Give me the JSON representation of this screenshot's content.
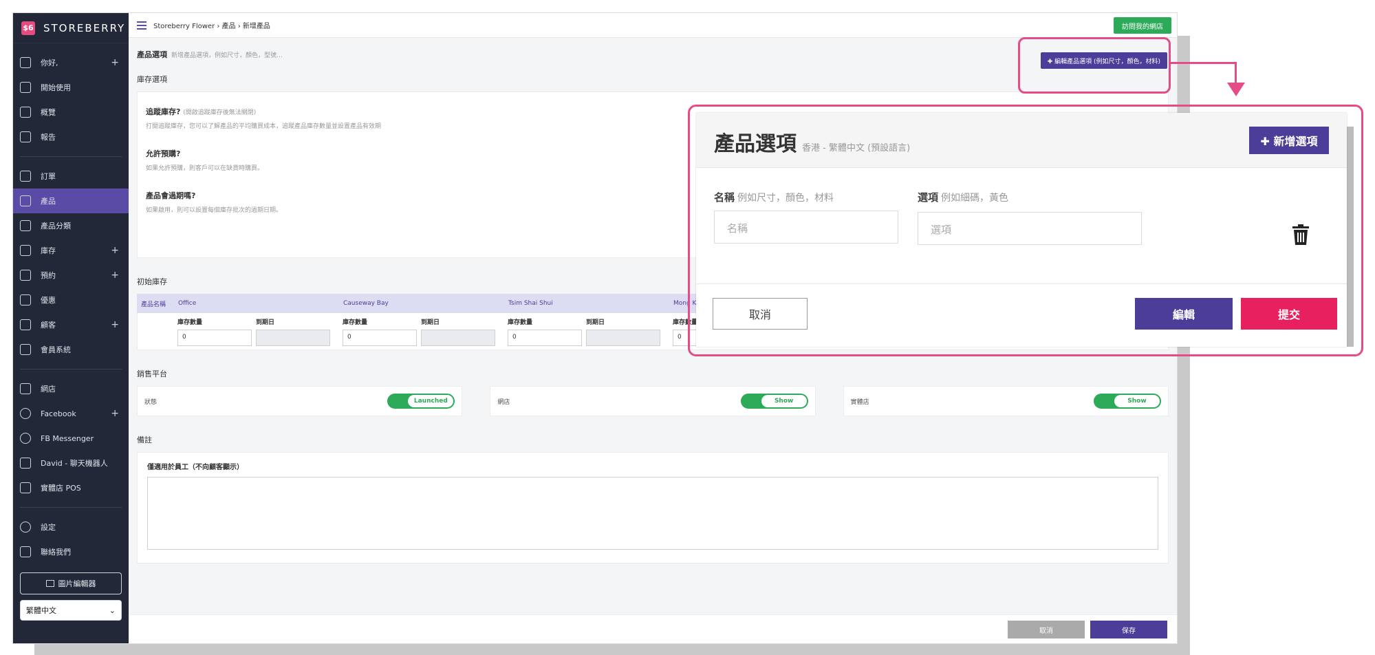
{
  "brand": {
    "name": "STOREBERRY",
    "logo": "$6"
  },
  "colors": {
    "accent": "#4b3d98",
    "highlight": "#e54b86",
    "success": "#2daa58",
    "danger": "#e8215e"
  },
  "sidebar": {
    "items": [
      {
        "label": "你好,",
        "icon": "user-icon",
        "plus": "+"
      },
      {
        "label": "開始使用",
        "icon": "flag-icon"
      },
      {
        "label": "概覽",
        "icon": "chart-icon"
      },
      {
        "label": "報告",
        "icon": "document-icon"
      },
      {
        "label": "訂單",
        "icon": "cart-icon"
      },
      {
        "label": "產品",
        "icon": "product-icon",
        "active": true
      },
      {
        "label": "產品分類",
        "icon": "list-icon"
      },
      {
        "label": "庫存",
        "icon": "box-icon",
        "plus": "+"
      },
      {
        "label": "預約",
        "icon": "calendar-icon",
        "plus": "+"
      },
      {
        "label": "優惠",
        "icon": "ticket-icon"
      },
      {
        "label": "顧客",
        "icon": "customer-icon",
        "plus": "+"
      },
      {
        "label": "會員系統",
        "icon": "member-icon"
      },
      {
        "label": "網店",
        "icon": "store-icon"
      },
      {
        "label": "Facebook",
        "icon": "facebook-icon",
        "plus": "+"
      },
      {
        "label": "FB Messenger",
        "icon": "messenger-icon"
      },
      {
        "label": "David - 聊天機器人",
        "icon": "bot-icon"
      },
      {
        "label": "實體店 POS",
        "icon": "pos-icon"
      },
      {
        "label": "設定",
        "icon": "gear-icon"
      },
      {
        "label": "聯絡我們",
        "icon": "help-icon"
      }
    ],
    "image_editor": "圖片編輯器",
    "language": "繁體中文"
  },
  "topbar": {
    "breadcrumb": "Storeberry Flower  ›  產品  ›  新增產品",
    "visit_store": "訪問我的網店"
  },
  "product_options": {
    "title": "產品選項",
    "subtitle": "新增產品選項，例如尺寸，顏色，型號…",
    "edit_button": "✚ 編輯產品選項 (例如尺寸，顏色，材料)"
  },
  "inventory": {
    "title": "庫存選項",
    "items": [
      {
        "title": "追蹤庫存?",
        "note": "(開啟追蹤庫存後無法關閉)",
        "desc": "打開追蹤庫存，您可以了解產品的平均購買成本，追蹤產品庫存數量並設置產品有效期"
      },
      {
        "title": "允許預購?",
        "note": "",
        "desc": "如果允許預購，則客戶可以在缺貨時購買。"
      },
      {
        "title": "產品會過期嗎?",
        "note": "",
        "desc": "如果啟用，則可以設置每個庫存批次的過期日期。"
      }
    ]
  },
  "initial_stock": {
    "title": "初始庫存",
    "product_name_label": "產品名稱",
    "locations": [
      "Office",
      "Causeway Bay",
      "Tsim Shai Shui",
      "Mong Kok",
      "",
      ""
    ],
    "qty_label": "庫存數量",
    "expiry_label": "到期日",
    "qty_value": "0"
  },
  "sales_platforms": {
    "title": "銷售平台",
    "items": [
      {
        "label": "狀態",
        "toggle": "Launched"
      },
      {
        "label": "網店",
        "toggle": "Show"
      },
      {
        "label": "實體店",
        "toggle": "Show"
      }
    ]
  },
  "notes": {
    "title": "備註",
    "label": "僅適用於員工（不向顧客顯示）"
  },
  "footer": {
    "cancel": "取消",
    "save": "保存"
  },
  "modal": {
    "title": "產品選項",
    "subtitle": "香港 - 繁體中文 (預設語言)",
    "add_button": "✚ 新增選項",
    "name_label": "名稱",
    "name_hint": "例如尺寸，顏色，材料",
    "name_placeholder": "名稱",
    "option_label": "選項",
    "option_hint": "例如細碼，黃色",
    "option_placeholder": "選項",
    "cancel": "取消",
    "edit": "編輯",
    "submit": "提交"
  }
}
